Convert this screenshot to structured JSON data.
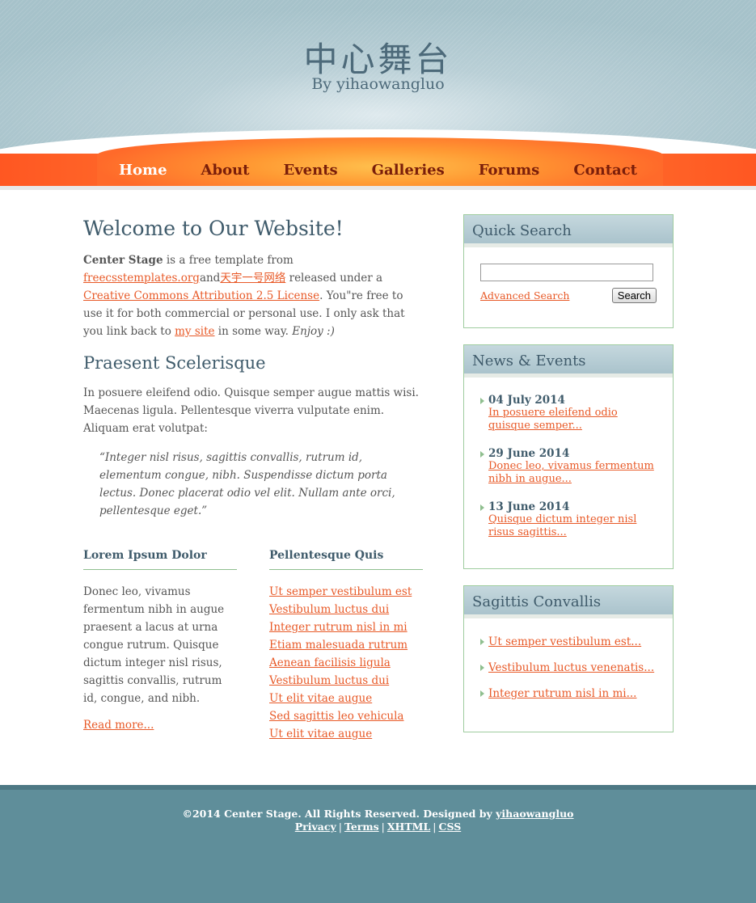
{
  "header": {
    "title": "中心舞台",
    "subtitle": "By yihaowangluo"
  },
  "nav": [
    {
      "label": "Home",
      "active": true
    },
    {
      "label": "About"
    },
    {
      "label": "Events"
    },
    {
      "label": "Galleries"
    },
    {
      "label": "Forums"
    },
    {
      "label": "Contact"
    }
  ],
  "main": {
    "heading": "Welcome to Our Website!",
    "intro": {
      "bold": "Center Stage",
      "t1": " is a free template from ",
      "link1": "freecsstemplates.org",
      "t2": "and",
      "link2": "天宇一号网络",
      "t3": " released under a ",
      "link3": "Creative Commons Attribution 2.5 License",
      "t4": ". You\"re free to use it for both commercial or personal use. I only ask that you link back to ",
      "link4": "my site",
      "t5": " in some way. ",
      "em": "Enjoy :)"
    },
    "subheading": "Praesent Scelerisque",
    "para": "In posuere eleifend odio. Quisque semper augue mattis wisi. Maecenas ligula. Pellentesque viverra vulputate enim. Aliquam erat volutpat:",
    "quote": "“Integer nisl risus, sagittis convallis, rutrum id, elementum congue, nibh. Suspendisse dictum porta lectus. Donec placerat odio vel elit. Nullam ante orci, pellentesque eget.”",
    "col1": {
      "heading": "Lorem Ipsum Dolor",
      "text": "Donec leo, vivamus fermentum nibh in augue praesent a lacus at urna congue rutrum. Quisque dictum integer nisl risus, sagittis convallis, rutrum id, congue, and nibh.",
      "readmore": "Read more..."
    },
    "col2": {
      "heading": "Pellentesque Quis",
      "links": [
        "Ut semper vestibulum est",
        "Vestibulum luctus dui",
        "Integer rutrum nisl in mi",
        "Etiam malesuada rutrum",
        "Aenean facilisis ligula",
        "Vestibulum luctus dui",
        "Ut elit vitae augue",
        "Sed sagittis leo vehicula",
        "Ut elit vitae augue"
      ]
    }
  },
  "sidebar": {
    "search": {
      "title": "Quick Search",
      "advanced": "Advanced Search",
      "button": "Search"
    },
    "news": {
      "title": "News & Events",
      "items": [
        {
          "date": "04 July 2014",
          "text": "In posuere eleifend odio quisque semper..."
        },
        {
          "date": "29 June 2014",
          "text": "Donec leo, vivamus fermentum nibh in augue..."
        },
        {
          "date": "13 June 2014",
          "text": "Quisque dictum integer nisl risus sagittis..."
        }
      ]
    },
    "sagittis": {
      "title": "Sagittis Convallis",
      "links": [
        "Ut semper vestibulum est...",
        "Vestibulum luctus venenatis...",
        "Integer rutrum nisl in mi..."
      ]
    }
  },
  "footer": {
    "copyright": "©2014 Center Stage. All Rights Reserved. Designed by ",
    "designer": "yihaowangluo",
    "links": [
      "Privacy",
      "Terms",
      "XHTML",
      "CSS"
    ],
    "separator": "|"
  }
}
